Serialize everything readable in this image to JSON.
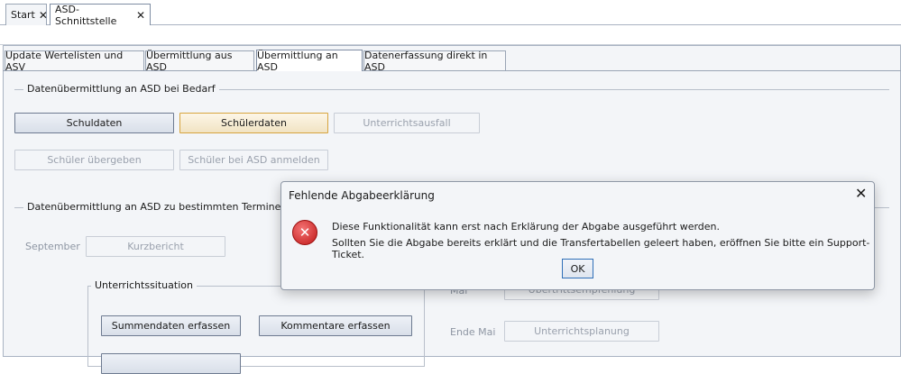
{
  "doc_tabs": [
    {
      "label": "Start",
      "close": "✕"
    },
    {
      "label": "ASD-Schnittstelle",
      "close": "✕"
    }
  ],
  "inner_tabs": [
    {
      "label": "Update Wertelisten und ASV"
    },
    {
      "label": "Übermittlung aus ASD"
    },
    {
      "label": "Übermittlung an ASD"
    },
    {
      "label": "Datenerfassung direkt in ASD"
    }
  ],
  "group_bedarf": {
    "title": "Datenübermittlung an ASD bei Bedarf",
    "schuldaten": "Schuldaten",
    "schuelerdaten": "Schülerdaten",
    "unterrichtsausfall": "Unterrichtsausfall",
    "schueler_uebergeben": "Schüler übergeben",
    "schueler_anmelden": "Schüler bei ASD anmelden"
  },
  "group_termine": {
    "title": "Datenübermittlung an ASD zu bestimmten Terminen",
    "september_label": "September",
    "kurzbericht": "Kurzbericht",
    "unterrichtssituation_title": "Unterrichtssituation",
    "summendaten": "Summendaten erfassen",
    "kommentare": "Kommentare erfassen",
    "mai_label": "Mai",
    "uebertrittsempfehlung": "Übertrittsempfehlung",
    "ende_mai_label": "Ende Mai",
    "unterrichtsplanung": "Unterrichtsplanung"
  },
  "dialog": {
    "title": "Fehlende Abgabeerklärung",
    "close": "✕",
    "icon": "error-icon",
    "icon_glyph": "✕",
    "line1": "Diese Funktionalität kann erst nach Erklärung der Abgabe ausgeführt werden.",
    "line2": "Sollten Sie die Abgabe bereits erklärt und die Transfertabellen geleert haben, eröffnen Sie bitte ein Support-Ticket.",
    "ok": "OK"
  }
}
